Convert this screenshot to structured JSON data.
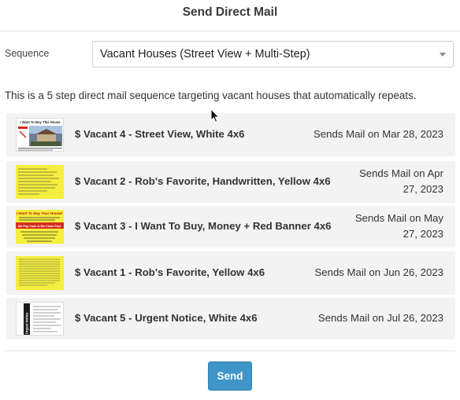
{
  "header": {
    "title": "Send Direct Mail"
  },
  "sequence": {
    "label": "Sequence",
    "selected": "Vacant Houses (Street View + Multi-Step)"
  },
  "description": "This is a 5 step direct mail sequence targeting vacant houses that automatically repeats.",
  "steps": [
    {
      "name": "$ Vacant 4 - Street View, White 4x6",
      "date": "Sends Mail on Mar 28, 2023",
      "thumb_headline": "I Want To Buy This House"
    },
    {
      "name": "$ Vacant 2 - Rob's Favorite, Handwritten, Yellow 4x6",
      "date_line1": "Sends Mail on Apr",
      "date_line2": "27, 2023"
    },
    {
      "name": "$ Vacant 3 - I Want To Buy, Money + Red Banner 4x6",
      "date_line1": "Sends Mail on May",
      "date_line2": "27, 2023",
      "thumb_headline": "I Want To Buy Your House!",
      "thumb_banner": "We Pay Cash & We Close Fast"
    },
    {
      "name": "$ Vacant 1 - Rob's Favorite, Yellow 4x6",
      "date": "Sends Mail on Jun 26, 2023"
    },
    {
      "name": "$ Vacant 5 - Urgent Notice, White 4x6",
      "date": "Sends Mail on Jul 26, 2023",
      "thumb_side_text": "Urgent Notice"
    }
  ],
  "actions": {
    "send_label": "Send"
  },
  "colors": {
    "primary_button": "#3f95c9",
    "row_bg": "#f3f3f3",
    "yellow_card": "#f4ee3c",
    "red_banner": "#d62d20"
  }
}
